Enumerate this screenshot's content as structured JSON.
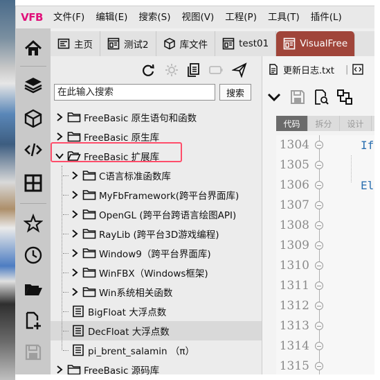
{
  "app": {
    "logo_text": "VFB",
    "logo_color": "#e0117a",
    "menu": [
      "文件(F)",
      "编辑(E)",
      "搜索(S)",
      "视图(V)",
      "工程(P)",
      "工具(T)",
      "插件(L)"
    ]
  },
  "tabs": [
    {
      "label": "主页",
      "icon": "home-page-icon"
    },
    {
      "label": "测试2",
      "icon": "form-window-icon"
    },
    {
      "label": "库文件",
      "icon": "cube-icon"
    },
    {
      "label": "test01",
      "icon": "form-window-icon"
    },
    {
      "label": "VisualFree",
      "icon": "form-window-icon",
      "active": true
    }
  ],
  "activitybar": [
    "home-icon",
    "layers-icon",
    "cube-icon",
    "code-icon",
    "grid-icon",
    "star-icon",
    "clock-icon",
    "open-folder-icon",
    "new-file-icon",
    "save-icon"
  ],
  "explorer": {
    "search_placeholder": "在此输入搜索",
    "search_button": "搜索",
    "tree": [
      {
        "label": "FreeBasic 原生语句和函数",
        "level": 0,
        "type": "folder",
        "expanded": false
      },
      {
        "label": "FreeBasic 原生库",
        "level": 0,
        "type": "folder",
        "expanded": false
      },
      {
        "label": "FreeBasic 扩展库",
        "level": 0,
        "type": "folder",
        "expanded": true,
        "highlighted": true
      },
      {
        "label": "C语言标准函数库",
        "level": 1,
        "type": "folder",
        "expanded": false
      },
      {
        "label": "MyFbFramework(跨平台界面库)",
        "level": 1,
        "type": "folder",
        "expanded": false
      },
      {
        "label": "OpenGL (跨平台跨语言绘图API)",
        "level": 1,
        "type": "folder",
        "expanded": false
      },
      {
        "label": "RayLib (跨平台3D游戏编程)",
        "level": 1,
        "type": "folder",
        "expanded": false
      },
      {
        "label": "Window9（跨平台界面库)",
        "level": 1,
        "type": "folder",
        "expanded": false
      },
      {
        "label": "WinFBX（Windows框架)",
        "level": 1,
        "type": "folder",
        "expanded": false
      },
      {
        "label": "Win系统相关函数",
        "level": 1,
        "type": "folder",
        "expanded": false
      },
      {
        "label": "BigFloat 大浮点数",
        "level": 1,
        "type": "doc"
      },
      {
        "label": "DecFloat 大浮点数",
        "level": 1,
        "type": "doc",
        "selected": true
      },
      {
        "label": "pi_brent_salamin （π）",
        "level": 1,
        "type": "doc"
      },
      {
        "label": "FreeBasic 源码库",
        "level": 0,
        "type": "folder",
        "expanded": false
      }
    ]
  },
  "editor": {
    "tabs": [
      {
        "label": "更新日志.txt",
        "icon": "text-file-icon"
      },
      {
        "label": "",
        "icon": "code-file-icon"
      }
    ],
    "view_tabs": [
      {
        "label": "代码",
        "active": true
      },
      {
        "label": "拆分"
      },
      {
        "label": "设计"
      }
    ],
    "lines": [
      {
        "number": "1304",
        "code": "If"
      },
      {
        "number": "1305",
        "code": ""
      },
      {
        "number": "1306",
        "code": "El"
      },
      {
        "number": "1307",
        "code": ""
      },
      {
        "number": "1308",
        "code": ""
      },
      {
        "number": "1309",
        "code": ""
      },
      {
        "number": "1310",
        "code": ""
      },
      {
        "number": "1311",
        "code": ""
      },
      {
        "number": "1312",
        "code": ""
      },
      {
        "number": "1313",
        "code": ""
      },
      {
        "number": "1314",
        "code": ""
      },
      {
        "number": "1315",
        "code": ""
      }
    ]
  }
}
